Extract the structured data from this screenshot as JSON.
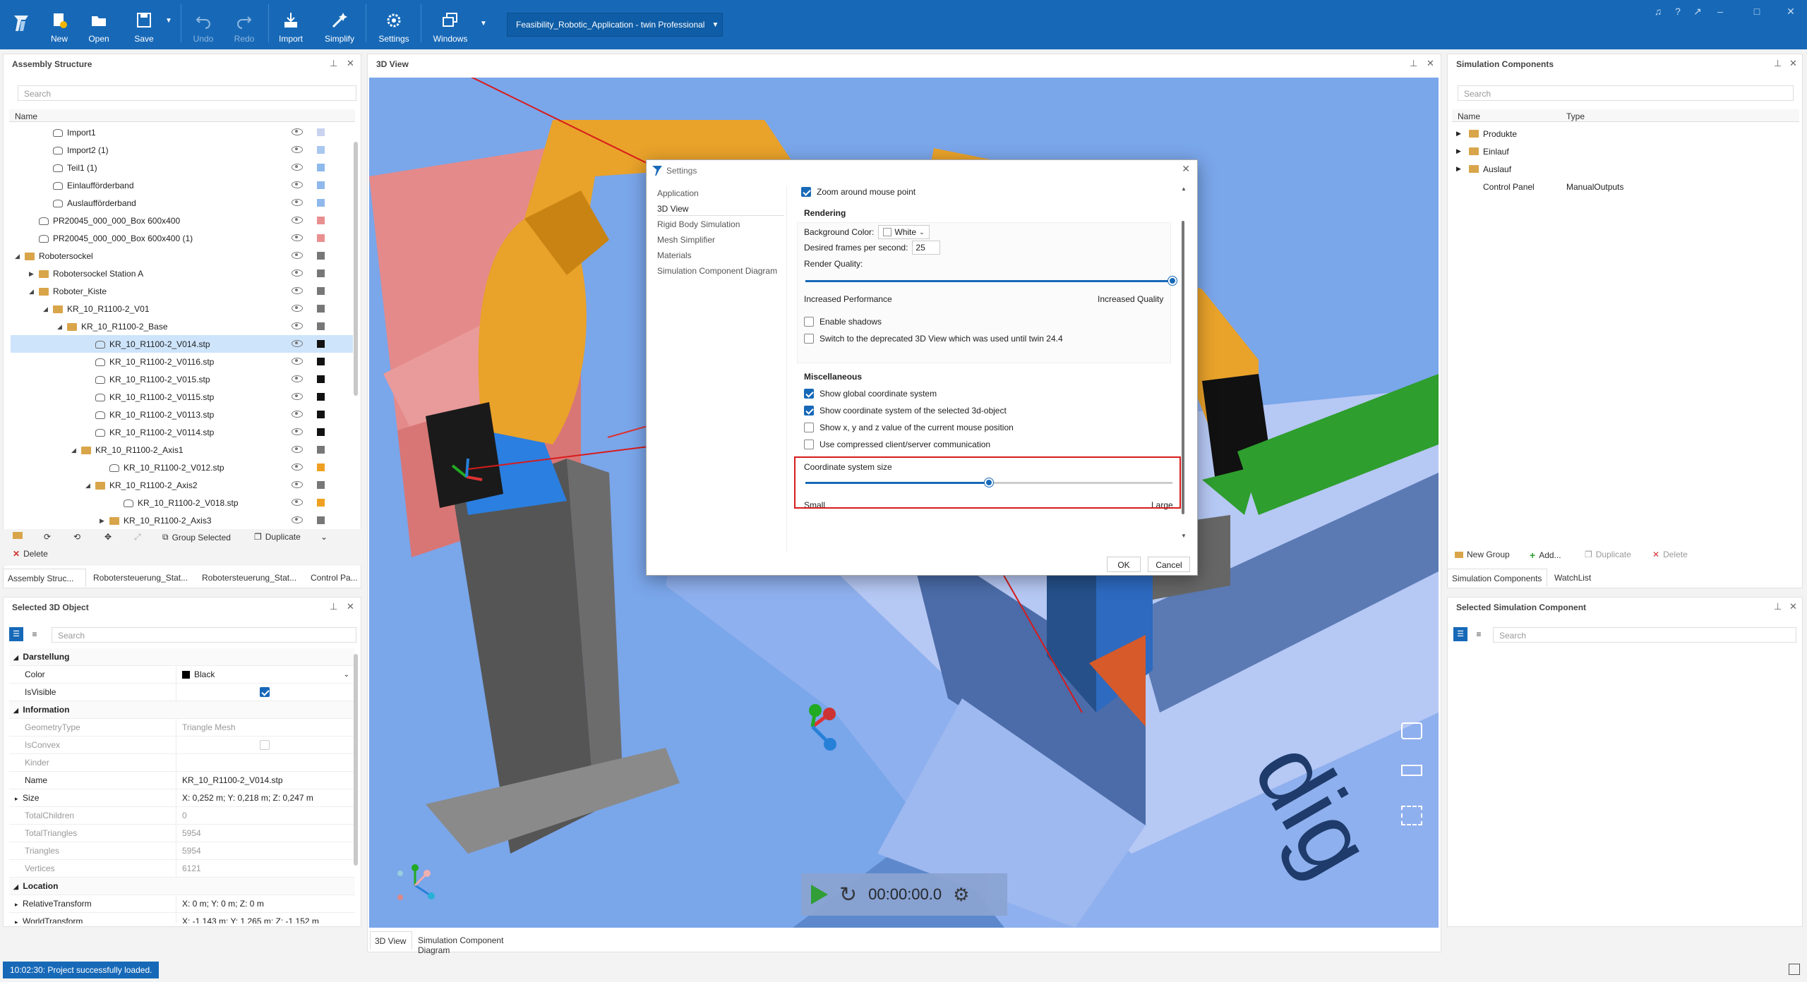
{
  "toolbar": {
    "new": "New",
    "open": "Open",
    "save": "Save",
    "undo": "Undo",
    "redo": "Redo",
    "import": "Import",
    "simplify": "Simplify",
    "settings": "Settings",
    "windows": "Windows",
    "project": "Feasibility_Robotic_Application - twin Professional"
  },
  "assembly": {
    "title": "Assembly Structure",
    "search_placeholder": "Search",
    "col_name": "Name",
    "rows": [
      {
        "label": "Import1",
        "indent": 3,
        "kind": "mesh",
        "swatch": "#c9d3ef"
      },
      {
        "label": "Import2 (1)",
        "indent": 3,
        "kind": "mesh",
        "swatch": "#a8c8f0"
      },
      {
        "label": "Teil1 (1)",
        "indent": 3,
        "kind": "mesh",
        "swatch": "#8fb8ec"
      },
      {
        "label": "Einlaufförderband",
        "indent": 3,
        "kind": "mesh",
        "swatch": "#8fb8ec"
      },
      {
        "label": "Auslaufförderband",
        "indent": 3,
        "kind": "mesh",
        "swatch": "#8fb8ec"
      },
      {
        "label": "PR20045_000_000_Box 600x400",
        "indent": 2,
        "kind": "mesh",
        "swatch": "#ea8f8f"
      },
      {
        "label": "PR20045_000_000_Box 600x400 (1)",
        "indent": 2,
        "kind": "mesh",
        "swatch": "#ea8f8f"
      },
      {
        "label": "Robotersockel",
        "indent": 1,
        "kind": "fold",
        "arrow": "◢",
        "swatch": "#777777"
      },
      {
        "label": "Robotersockel Station A",
        "indent": 2,
        "kind": "fold",
        "arrow": "▶",
        "swatch": "#777777"
      },
      {
        "label": "Roboter_Kiste",
        "indent": 2,
        "kind": "fold",
        "arrow": "◢",
        "swatch": "#777777"
      },
      {
        "label": "KR_10_R1100-2_V01",
        "indent": 3,
        "kind": "fold",
        "arrow": "◢",
        "swatch": "#777777"
      },
      {
        "label": "KR_10_R1100-2_Base",
        "indent": 4,
        "kind": "fold",
        "arrow": "◢",
        "swatch": "#777777"
      },
      {
        "label": "KR_10_R1100-2_V014.stp",
        "indent": 6,
        "kind": "mesh",
        "swatch": "#111111",
        "selected": true
      },
      {
        "label": "KR_10_R1100-2_V0116.stp",
        "indent": 6,
        "kind": "mesh",
        "swatch": "#111111"
      },
      {
        "label": "KR_10_R1100-2_V015.stp",
        "indent": 6,
        "kind": "mesh",
        "swatch": "#111111"
      },
      {
        "label": "KR_10_R1100-2_V0115.stp",
        "indent": 6,
        "kind": "mesh",
        "swatch": "#111111"
      },
      {
        "label": "KR_10_R1100-2_V0113.stp",
        "indent": 6,
        "kind": "mesh",
        "swatch": "#111111"
      },
      {
        "label": "KR_10_R1100-2_V0114.stp",
        "indent": 6,
        "kind": "mesh",
        "swatch": "#111111"
      },
      {
        "label": "KR_10_R1100-2_Axis1",
        "indent": 5,
        "kind": "fold",
        "arrow": "◢",
        "swatch": "#777777"
      },
      {
        "label": "KR_10_R1100-2_V012.stp",
        "indent": 7,
        "kind": "mesh",
        "swatch": "#f0a020"
      },
      {
        "label": "KR_10_R1100-2_Axis2",
        "indent": 6,
        "kind": "fold",
        "arrow": "◢",
        "swatch": "#777777"
      },
      {
        "label": "KR_10_R1100-2_V018.stp",
        "indent": 8,
        "kind": "mesh",
        "swatch": "#f0a020"
      },
      {
        "label": "KR_10_R1100-2_Axis3",
        "indent": 7,
        "kind": "fold",
        "arrow": "▶",
        "swatch": "#777777"
      }
    ],
    "tools": {
      "group_selected": "Group Selected",
      "duplicate": "Duplicate",
      "delete": "Delete"
    },
    "tabs": [
      "Assembly Struc...",
      "Robotersteuerung_Stat...",
      "Robotersteuerung_Stat...",
      "Control Pa..."
    ]
  },
  "selected3d": {
    "title": "Selected 3D Object",
    "search_placeholder": "Search",
    "rows": [
      {
        "k": "Darstellung",
        "type": "grp"
      },
      {
        "k": "Color",
        "v": "Black",
        "type": "color"
      },
      {
        "k": "IsVisible",
        "type": "check",
        "checked": true
      },
      {
        "k": "Information",
        "type": "grp"
      },
      {
        "k": "GeometryType",
        "v": "Triangle Mesh",
        "type": "dim"
      },
      {
        "k": "IsConvex",
        "type": "checkdim"
      },
      {
        "k": "Kinder",
        "v": "",
        "type": "dim"
      },
      {
        "k": "Name",
        "v": "KR_10_R1100-2_V014.stp"
      },
      {
        "k": "Size",
        "v": "X: 0,252 m; Y: 0,218 m; Z: 0,247 m",
        "type": "exp"
      },
      {
        "k": "TotalChildren",
        "v": "0",
        "type": "dim"
      },
      {
        "k": "TotalTriangles",
        "v": "5954",
        "type": "dim"
      },
      {
        "k": "Triangles",
        "v": "5954",
        "type": "dim"
      },
      {
        "k": "Vertices",
        "v": "6121",
        "type": "dim"
      },
      {
        "k": "Location",
        "type": "grp"
      },
      {
        "k": "RelativeTransform",
        "v": "X: 0 m; Y: 0 m; Z: 0 m",
        "type": "exp"
      },
      {
        "k": "WorldTransform",
        "v": "X: -1,143 m; Y: 1,265 m; Z: -1,152 m",
        "type": "exp"
      }
    ]
  },
  "view3d": {
    "title": "3D View",
    "timer": "00:00:00.0",
    "tabs": [
      "3D View",
      "Simulation Component Diagram"
    ]
  },
  "settings": {
    "title": "Settings",
    "nav": [
      "Application",
      "3D View",
      "Rigid Body Simulation",
      "Mesh Simplifier",
      "Materials",
      "Simulation Component Diagram"
    ],
    "zoom_label": "Zoom around mouse point",
    "rendering": "Rendering",
    "bg_label": "Background Color:",
    "bg_value": "White",
    "fps_label": "Desired frames per second:",
    "fps_value": "25",
    "quality_label": "Render Quality:",
    "quality_value": 1.0,
    "perf": "Increased Performance",
    "qual": "Increased Quality",
    "shadows": "Enable shadows",
    "deprecated": "Switch to the deprecated 3D View which was used until twin 24.4",
    "misc": "Miscellaneous",
    "global_cs": "Show global coordinate system",
    "selected_cs": "Show coordinate system of the selected 3d-object",
    "xyz": "Show x, y and z value of the current mouse position",
    "compressed": "Use compressed client/server communication",
    "cs_size": "Coordinate system size",
    "cs_size_value": 0.5,
    "small": "Small",
    "large": "Large",
    "ok": "OK",
    "cancel": "Cancel"
  },
  "simcomp": {
    "title": "Simulation Components",
    "search_placeholder": "Search",
    "col_name": "Name",
    "col_type": "Type",
    "rows": [
      {
        "name": "Produkte",
        "type": "",
        "folder": true
      },
      {
        "name": "Einlauf",
        "type": "",
        "folder": true
      },
      {
        "name": "Auslauf",
        "type": "",
        "folder": true
      },
      {
        "name": "Control Panel",
        "type": "ManualOutputs",
        "folder": false
      }
    ],
    "tools": {
      "new_group": "New Group",
      "add": "Add...",
      "duplicate": "Duplicate",
      "delete": "Delete"
    },
    "tabs": [
      "Simulation Components",
      "WatchList"
    ]
  },
  "selsimcomp": {
    "title": "Selected Simulation Component",
    "search_placeholder": "Search"
  },
  "status": "10:02:30: Project successfully loaded."
}
